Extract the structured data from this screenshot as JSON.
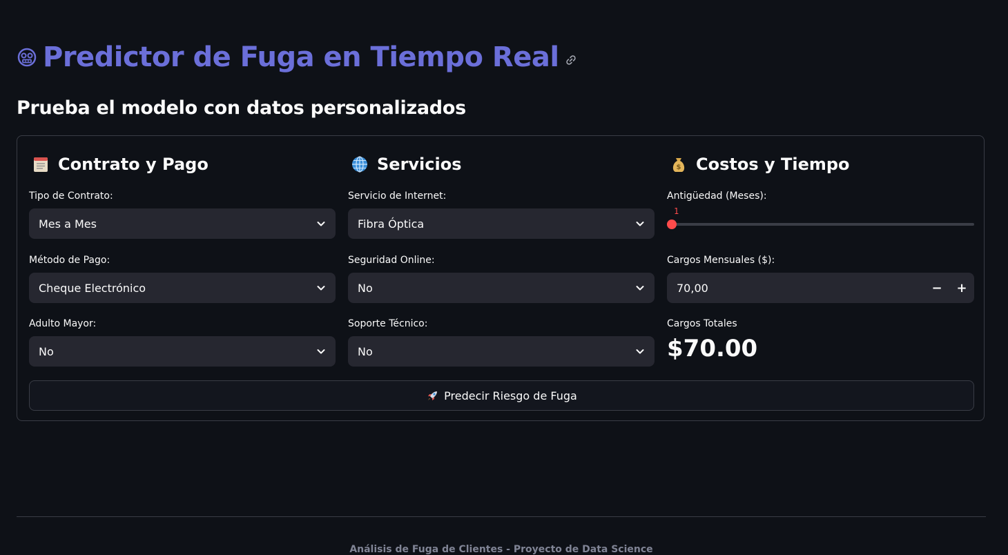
{
  "page": {
    "title": "Predictor de Fuga en Tiempo Real",
    "title_icon": "robot-face-icon",
    "subtitle": "Prueba el modelo con datos personalizados",
    "footer": "Análisis de Fuga de Clientes - Proyecto de Data Science"
  },
  "colors": {
    "background": "#0e1117",
    "title": "#6b6fd9",
    "accent": "#ff4b4b",
    "input_bg": "#262730",
    "border": "#3a3d46"
  },
  "contract": {
    "header": "Contrato y Pago",
    "header_icon": "clipboard-icon",
    "contract_type_label": "Tipo de Contrato:",
    "contract_type_value": "Mes a Mes",
    "payment_method_label": "Método de Pago:",
    "payment_method_value": "Cheque Electrónico",
    "senior_label": "Adulto Mayor:",
    "senior_value": "No"
  },
  "services": {
    "header": "Servicios",
    "header_icon": "globe-icon",
    "internet_label": "Servicio de Internet:",
    "internet_value": "Fibra Óptica",
    "security_label": "Seguridad Online:",
    "security_value": "No",
    "support_label": "Soporte Técnico:",
    "support_value": "No"
  },
  "costs": {
    "header": "Costos y Tiempo",
    "header_icon": "money-bag-icon",
    "tenure_label": "Antigüedad (Meses):",
    "tenure_value": "1",
    "tenure_fraction": 0.0,
    "monthly_label": "Cargos Mensuales ($):",
    "monthly_value": "70,00",
    "minus_label": "−",
    "plus_label": "+",
    "total_label": "Cargos Totales",
    "total_value": "$70.00"
  },
  "actions": {
    "predict_label": "Predecir Riesgo de Fuga",
    "predict_icon": "rocket-icon"
  }
}
